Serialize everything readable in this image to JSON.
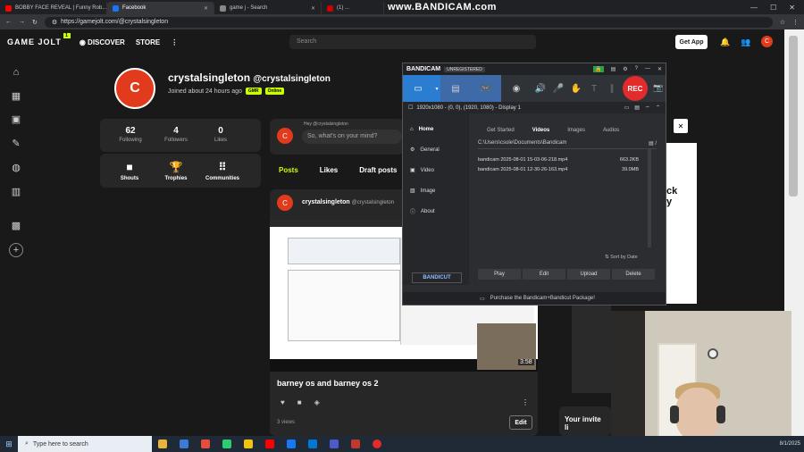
{
  "browser": {
    "tabs": [
      {
        "label": "BOBBY FACE REVEAL | Funny Rob...",
        "color": "#ff0000"
      },
      {
        "label": "Facebook",
        "color": "#1877f2"
      },
      {
        "label": "game j - Search",
        "color": "#888888"
      },
      {
        "label": "(1) ...",
        "color": "#cc0000"
      }
    ],
    "watermark": "www.BANDICAM.com",
    "url": "https://gamejolt.com/@crystalsingleton"
  },
  "gj_header": {
    "logo": "GAME JOLT",
    "logo_badge": "1",
    "discover": "DISCOVER",
    "store": "STORE",
    "search_placeholder": "Search",
    "get_app": "Get App",
    "avatar_letter": "C"
  },
  "profile": {
    "avatar_letter": "C",
    "display_name": "crystalsingleton",
    "handle": "@crystalsingleton",
    "joined": "Joined about 24 hours ago",
    "badges": [
      "GMR",
      "Online"
    ],
    "stats": [
      {
        "num": "62",
        "label": "Following"
      },
      {
        "num": "4",
        "label": "Followers"
      },
      {
        "num": "0",
        "label": "Likes"
      }
    ],
    "actions": [
      {
        "label": "Shouts"
      },
      {
        "label": "Trophies"
      },
      {
        "label": "Communities"
      }
    ]
  },
  "compose": {
    "greeting": "Hey @crystalsingleton",
    "placeholder": "So, what's on your mind?"
  },
  "post_tabs": [
    "Posts",
    "Likes",
    "Draft posts"
  ],
  "feed_post": {
    "author": "crystalsingleton",
    "handle": "@crystalsingleton",
    "video_time": "3:58",
    "title": "barney os and barney os 2",
    "views": "3 views",
    "edit": "Edit"
  },
  "invite_text": "Your invite li",
  "bandicam": {
    "brand": "BANDICAM",
    "unregistered": "UNREGISTERED",
    "rec": "REC",
    "resolution": "1920x1080 - (0, 0), (1920, 1080) - Display 1",
    "sidebar": [
      "Home",
      "General",
      "Video",
      "Image",
      "About"
    ],
    "tabs": [
      "Get Started",
      "Videos",
      "Images",
      "Audios"
    ],
    "path": "C:\\Users\\csole\\Documents\\Bandicam",
    "files": [
      {
        "name": "bandicam 2025-08-01 15-03-06-218.mp4",
        "size": "663.2KB"
      },
      {
        "name": "bandicam 2025-08-01 12-30-26-163.mp4",
        "size": "39.0MB"
      }
    ],
    "sort": "Sort by Date",
    "buttons": [
      "Play",
      "Edit",
      "Upload",
      "Delete"
    ],
    "bandicut": "BANDICUT",
    "footer": "Purchase the Bandicam+Bandicut Package!"
  },
  "taskbar": {
    "search": "Type here to search",
    "date": "8/1/2025",
    "apps": [
      "#e8b43a",
      "#3a7bd5",
      "#e74c3c",
      "#2ecc71",
      "#f1c40f",
      "#ff0000",
      "#1877f2",
      "#0078d4",
      "#5059c9",
      "#c0392b",
      "#e22b2b"
    ]
  }
}
